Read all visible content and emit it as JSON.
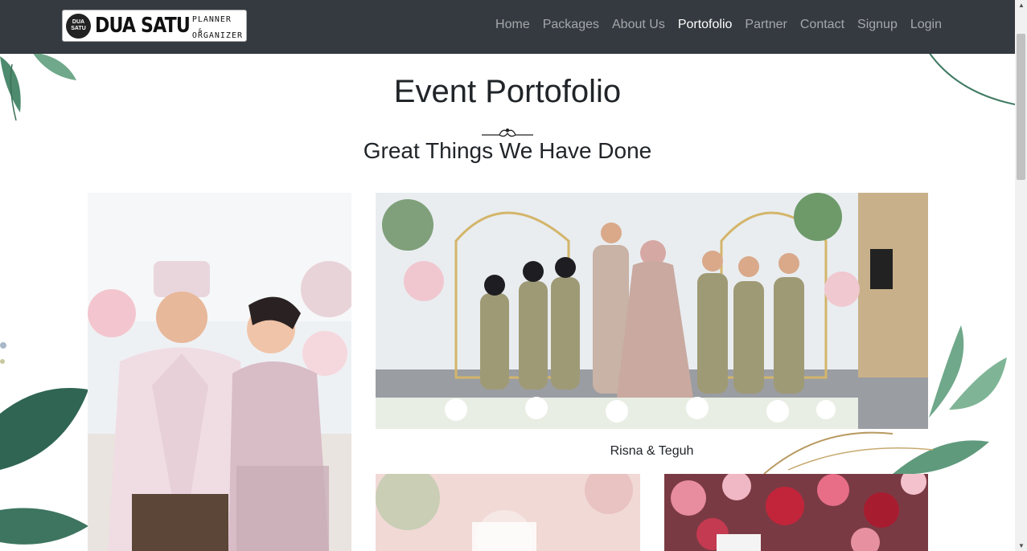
{
  "brand": {
    "circle_text_line1": "DUA",
    "circle_text_line2": "SATU",
    "name": "DUA SATU",
    "side_line1": "PLANNER",
    "side_line2": "&",
    "side_line3": "ORGANIZER"
  },
  "nav": {
    "items": [
      {
        "label": "Home"
      },
      {
        "label": "Packages"
      },
      {
        "label": "About Us"
      },
      {
        "label": "Portofolio",
        "active": true
      },
      {
        "label": "Partner"
      },
      {
        "label": "Contact"
      },
      {
        "label": "Signup"
      },
      {
        "label": "Login"
      }
    ]
  },
  "section": {
    "title": "Event Portofolio",
    "subtitle": "Great Things We Have Done"
  },
  "portfolio": {
    "items": [
      {
        "caption": ""
      },
      {
        "caption": "Risna & Teguh"
      },
      {
        "caption": ""
      },
      {
        "caption": ""
      }
    ]
  },
  "colors": {
    "navbar": "#343a40",
    "nav_text": "#9a9da0",
    "nav_active": "#ffffff",
    "leaf_green": "#3f7a62"
  }
}
